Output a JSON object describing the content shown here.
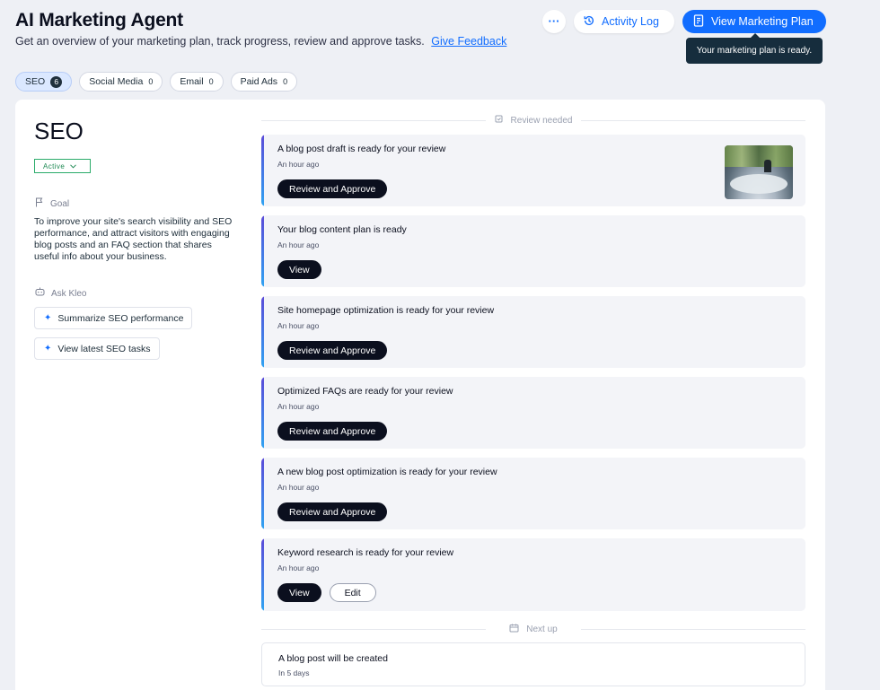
{
  "header": {
    "title": "AI Marketing Agent",
    "subtitle": "Get an overview of your marketing plan, track progress, review and approve tasks.",
    "feedback_link": "Give Feedback",
    "more_label": "···",
    "activity_log_label": "Activity Log",
    "view_plan_label": "View Marketing Plan",
    "tooltip": "Your marketing plan is ready."
  },
  "tabs": [
    {
      "label": "SEO",
      "count": "6",
      "active": true
    },
    {
      "label": "Social Media",
      "count": "0",
      "active": false
    },
    {
      "label": "Email",
      "count": "0",
      "active": false
    },
    {
      "label": "Paid Ads",
      "count": "0",
      "active": false
    }
  ],
  "sidebar": {
    "heading": "SEO",
    "status": "Active",
    "goal_label": "Goal",
    "goal_text": "To improve your site's search visibility and SEO performance, and attract visitors with engaging blog posts and an FAQ section that shares useful info about your business.",
    "ask_label": "Ask Kleo",
    "ask_buttons": [
      "Summarize SEO performance",
      "View latest SEO tasks"
    ]
  },
  "review_section": {
    "label": "Review needed",
    "cards": [
      {
        "title": "A blog post draft is ready for your review",
        "time": "An hour ago",
        "primary": "Review and Approve"
      },
      {
        "title": "Your blog content plan is ready",
        "time": "An hour ago",
        "primary": "View"
      },
      {
        "title": "Site homepage optimization is ready for your review",
        "time": "An hour ago",
        "primary": "Review and Approve"
      },
      {
        "title": "Optimized FAQs are ready for your review",
        "time": "An hour ago",
        "primary": "Review and Approve"
      },
      {
        "title": "A new blog post optimization is ready for your review",
        "time": "An hour ago",
        "primary": "Review and Approve"
      },
      {
        "title": "Keyword research is ready for your review",
        "time": "An hour ago",
        "primary": "View",
        "secondary": "Edit"
      }
    ]
  },
  "next_section": {
    "label": "Next up",
    "cards": [
      {
        "title": "A blog post will be created",
        "time": "In 5 days"
      }
    ]
  },
  "colors": {
    "accent": "#116dff",
    "dark_button": "#0b0f1e",
    "status_green": "#2aab6a",
    "card_bar_top": "#5b4bd8",
    "card_bar_bottom": "#2fa3f2",
    "background": "#eef0f5"
  },
  "icons": {
    "more": "more-dots-icon",
    "activity": "history-icon",
    "plan": "document-icon",
    "goal": "flag-icon",
    "ask": "chat-bot-icon",
    "sparkle": "sparkle-icon",
    "review": "review-icon",
    "next": "calendar-icon"
  }
}
